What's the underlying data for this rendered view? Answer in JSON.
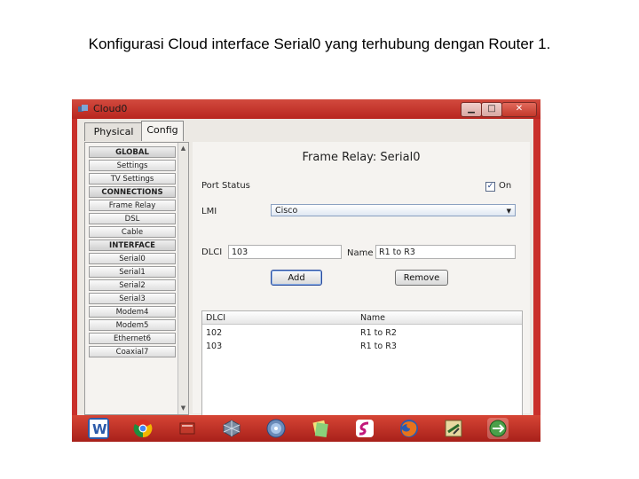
{
  "caption": "Konfigurasi Cloud interface Serial0 yang terhubung dengan Router 1.",
  "window": {
    "title": "Cloud0"
  },
  "tabs": [
    {
      "label": "Physical"
    },
    {
      "label": "Config"
    }
  ],
  "sidebar": {
    "items": [
      {
        "label": "GLOBAL",
        "header": true
      },
      {
        "label": "Settings"
      },
      {
        "label": "TV Settings"
      },
      {
        "label": "CONNECTIONS",
        "header": true
      },
      {
        "label": "Frame Relay"
      },
      {
        "label": "DSL"
      },
      {
        "label": "Cable"
      },
      {
        "label": "INTERFACE",
        "header": true
      },
      {
        "label": "Serial0"
      },
      {
        "label": "Serial1"
      },
      {
        "label": "Serial2"
      },
      {
        "label": "Serial3"
      },
      {
        "label": "Modem4"
      },
      {
        "label": "Modem5"
      },
      {
        "label": "Ethernet6"
      },
      {
        "label": "Coaxial7"
      }
    ]
  },
  "panel": {
    "title": "Frame Relay: Serial0",
    "port_status_label": "Port Status",
    "port_status_on": "On",
    "port_status_checked": true,
    "lmi_label": "LMI",
    "lmi_value": "Cisco",
    "dlci_label": "DLCI",
    "dlci_value": "103",
    "name_label": "Name",
    "name_value": "R1 to R3",
    "add_label": "Add",
    "remove_label": "Remove",
    "table": {
      "headers": [
        "DLCI",
        "Name"
      ],
      "rows": [
        [
          "102",
          "R1 to R2"
        ],
        [
          "103",
          "R1 to R3"
        ]
      ]
    }
  },
  "taskbar": {
    "icons": [
      "word-icon",
      "chrome-icon",
      "book-icon",
      "virtualbox-icon",
      "disc-icon",
      "notes-icon",
      "flashget-icon",
      "firefox-icon",
      "packet-tracer-icon",
      "network-globe-icon"
    ]
  },
  "colors": {
    "accent": "#c9302b",
    "client_bg": "#ece9e4"
  }
}
